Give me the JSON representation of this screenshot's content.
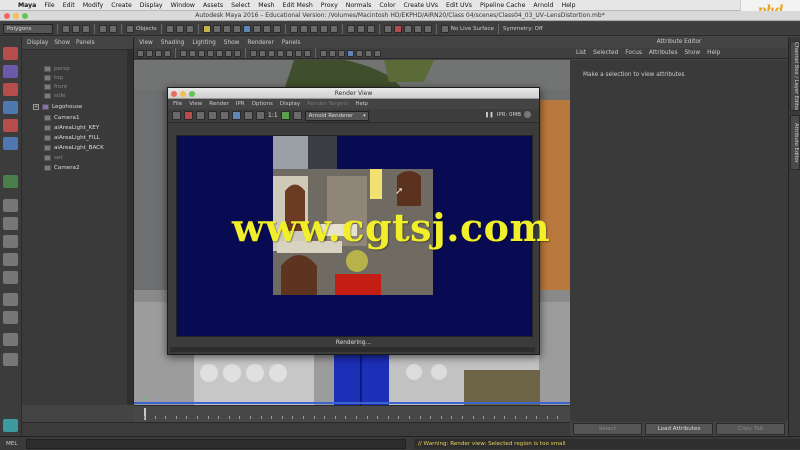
{
  "mac_menu": {
    "app": "Maya",
    "items": [
      "File",
      "Edit",
      "Modify",
      "Create",
      "Display",
      "Window",
      "Assets",
      "Select",
      "Mesh",
      "Edit Mesh",
      "Proxy",
      "Normals",
      "Color",
      "Create UVs",
      "Edit UVs",
      "Pipeline Cache",
      "Arnold",
      "Help"
    ]
  },
  "window_title": "Autodesk Maya 2016 – Educational Version: /Volumes/Macintosh HD/EKPHD/AIRN20/Class 04/scenes/Class04_03_UV–LensDistortion.mb*",
  "watermark_logo": "phd",
  "status_line": {
    "mode": "Polygons",
    "objects_label": "Objects",
    "no_live_surface": "No Live Surface",
    "symmetry": "Symmetry: Off"
  },
  "outliner": {
    "menu": [
      "Display",
      "Show",
      "Panels"
    ],
    "items": [
      {
        "label": "persp",
        "dim": true
      },
      {
        "label": "top",
        "dim": true
      },
      {
        "label": "front",
        "dim": true
      },
      {
        "label": "side",
        "dim": true
      },
      {
        "label": "Legohouse",
        "dim": false,
        "expand": "+"
      },
      {
        "label": "Camera1",
        "dim": false
      },
      {
        "label": "aiAreaLight_KEY",
        "dim": false
      },
      {
        "label": "aiAreaLight_FILL",
        "dim": false
      },
      {
        "label": "aiAreaLight_BACK",
        "dim": false
      },
      {
        "label": "set",
        "dim": true
      },
      {
        "label": "Camera2",
        "dim": false
      }
    ]
  },
  "viewport_menu": [
    "View",
    "Shading",
    "Lighting",
    "Show",
    "Renderer",
    "Panels"
  ],
  "render_view": {
    "title": "Render View",
    "menu": [
      "File",
      "View",
      "Render",
      "IPR",
      "Options",
      "Display",
      "Render Targets",
      "Help"
    ],
    "disabled_menu": "Render Targets",
    "zoom_label": "1:1",
    "renderer": "Arnold Renderer",
    "ipr_label": "IPR: 0MB",
    "status": "Rendering..."
  },
  "attribute_editor": {
    "title": "Attribute Editor",
    "menu": [
      "List",
      "Selected",
      "Focus",
      "Attributes",
      "Show",
      "Help"
    ],
    "message": "Make a selection to view attributes",
    "buttons": {
      "select": "Select",
      "load": "Load Attributes",
      "copy": "Copy Tab"
    }
  },
  "side_tabs": [
    "Channel Box / Layer Editor",
    "Attribute Editor"
  ],
  "command_line": {
    "mel_label": "MEL",
    "warning": "// Warning: Render view: Selected region is too small"
  },
  "site_watermark": "www.cgtsj.com"
}
